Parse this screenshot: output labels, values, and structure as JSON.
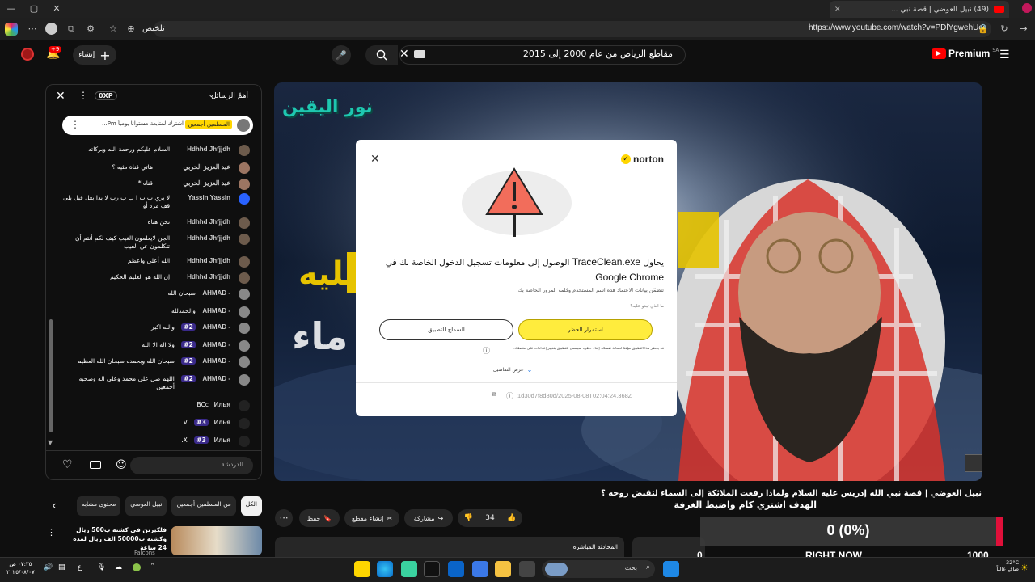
{
  "browser": {
    "tab_title": "(49) نبيل العوضي | قصة نبي ...",
    "summarize_label": "تلخيص",
    "url": "https://www.youtube.com/watch?v=PDlYgwehUcc"
  },
  "youtube": {
    "premium_label": "Premium",
    "premium_region": "SA",
    "search_query": "مقاطع الرياض من عام 2000 إلى 2015",
    "create_label": "إنشاء",
    "notifications_count": "+9"
  },
  "chat": {
    "header_label": "أهمّ الرسائل",
    "points_label": "0XP",
    "pinned": {
      "author": "المسلمين أجمعين",
      "text": "اشترك لمتابعة مستوانا يومياً Pm..."
    },
    "messages": [
      {
        "author": "Hdhhd Jhfjjdh",
        "text": "السلام عليكم ورحمة الله وبركاته",
        "badge": ""
      },
      {
        "author": "عبد العزيز الحربي",
        "text": "هاتي قناة مثيه ؟",
        "badge": ""
      },
      {
        "author": "عبد العزيز الحربي",
        "text": "قناه *",
        "badge": ""
      },
      {
        "author": "Yassin Yassin",
        "text": "لا يري ب ب ا ب ب رب لا بدا بغل قبل بلى قف مرد أو",
        "badge": ""
      },
      {
        "author": "Hdhhd Jhfjjdh",
        "text": "نحن هناه",
        "badge": ""
      },
      {
        "author": "Hdhhd Jhfjjdh",
        "text": "الجن لايعلمون الغيب كيف لكم أنتم أن تتكلمون عن الغيب",
        "badge": ""
      },
      {
        "author": "Hdhhd Jhfjjdh",
        "text": "الله أعلى واعظم",
        "badge": ""
      },
      {
        "author": "Hdhhd Jhfjjdh",
        "text": "إن الله هو العليم الحكيم",
        "badge": ""
      },
      {
        "author": "- AHMAD",
        "text": "سبحان الله",
        "badge": ""
      },
      {
        "author": "- AHMAD",
        "text": "والحمدلله",
        "badge": ""
      },
      {
        "author": "- AHMAD",
        "text": "والله اكبر",
        "badge": "#2"
      },
      {
        "author": "- AHMAD",
        "text": "ولا اله الا الله",
        "badge": "#2"
      },
      {
        "author": "- AHMAD",
        "text": "سبحان الله وبحمده سبحان الله العظيم",
        "badge": "#2"
      },
      {
        "author": "- AHMAD",
        "text": "اللهم صل على محمد وعلى اله وصحبه أجمعين",
        "badge": "#2"
      },
      {
        "author": "Илья",
        "text": "BCc",
        "badge": ""
      },
      {
        "author": "Илья",
        "text": "V",
        "badge": "#3"
      },
      {
        "author": "Илья",
        "text": "X.",
        "badge": "#3"
      }
    ],
    "input_placeholder": "الدردشة..."
  },
  "norton": {
    "brand": "norton",
    "headline_prefix": "يحاول ",
    "headline_app": "TraceClean.exe",
    "headline_mid": " الوصول إلى معلومات تسجيل الدخول الخاصة بك في ",
    "headline_target": "Google Chrome.",
    "subtext": "تتضمّن بيانات الاعتماد هذه اسم المستخدم وكلمة المرور الخاصة بك.",
    "what_link": "ما الذي تبدو عليه؟",
    "continue_label": "استمرار الحظر",
    "allow_label": "السماح للتطبيق",
    "info_note": "قد يحظر هذا التطبيق مؤقتاً لحماية نفسك. إلغاء حظره سيسمح للتطبيق بتغيير إعدادات على متصفّك.",
    "details_label": "عرض التفاصيل",
    "event_id": "1d30d7f8d80d/2025-08-08T02:04:24.368Z"
  },
  "video": {
    "channel_logo_text": "نور اليقين",
    "title": "نبيل العوضي | قصة نبي الله إدريس عليه السلام ولماذا رفعت الملائكة إلى السماء لتقبض روحه ؟",
    "overlay_caption": "الهدف اشتري كام واضبط الغرفة",
    "like_count": "34",
    "share_label": "مشاركة",
    "clip_label": "إنشاء مقطع",
    "save_label": "حفظ",
    "chips": [
      "الكل",
      "من المسلمين أجمعين",
      "نبيل العوضي",
      "محتوى مشابه"
    ],
    "rec_title": "فلكيرتن في كشنة ب500 ريال وكشنة ب50000 الف ريال لمدة 24 ساعة",
    "rec_channel": "Falcons",
    "live_chat_label": "المحادثة المباشرة"
  },
  "counter": {
    "value": "0 (0%)",
    "min": "0",
    "max": "1000",
    "label": "RIGHT NOW"
  },
  "taskbar": {
    "search_label": "بحث",
    "weather_temp": "32°C",
    "weather_text": "صافٍ غالباً",
    "time": "٠٧:٣٥ ص",
    "date": "٢٠٢٥/٠٨/٠٧"
  }
}
